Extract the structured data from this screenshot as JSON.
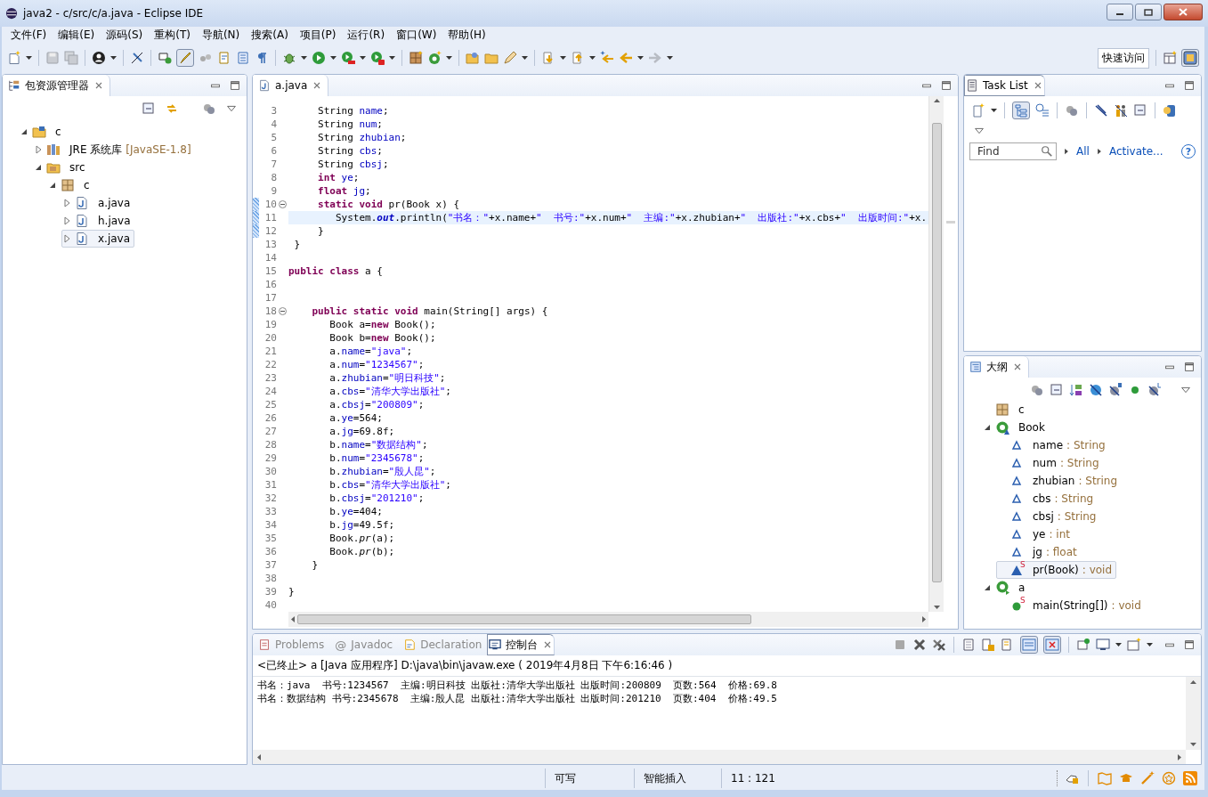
{
  "window": {
    "title": "java2 - c/src/c/a.java - Eclipse IDE"
  },
  "menu": [
    "文件(F)",
    "编辑(E)",
    "源码(S)",
    "重构(T)",
    "导航(N)",
    "搜索(A)",
    "项目(P)",
    "运行(R)",
    "窗口(W)",
    "帮助(H)"
  ],
  "toolbar": {
    "quick_access": "快速访问"
  },
  "package_explorer": {
    "title": "包资源管理器",
    "tree": [
      {
        "kind": "project",
        "label": "c",
        "expanded": true,
        "selected": false,
        "children": [
          {
            "kind": "library",
            "label": "JRE 系统库",
            "decoration": "[JavaSE-1.8]",
            "expanded": false,
            "selected": false
          },
          {
            "kind": "source-folder",
            "label": "src",
            "expanded": true,
            "selected": false,
            "children": [
              {
                "kind": "package",
                "label": "c",
                "expanded": true,
                "selected": false,
                "children": [
                  {
                    "kind": "java-file",
                    "label": "a.java",
                    "expanded": false,
                    "selected": false
                  },
                  {
                    "kind": "java-file",
                    "label": "h.java",
                    "expanded": false,
                    "selected": false
                  },
                  {
                    "kind": "java-file",
                    "label": "x.java",
                    "expanded": false,
                    "selected": true
                  }
                ]
              }
            ]
          }
        ]
      }
    ]
  },
  "editor": {
    "tabs": [
      {
        "label": "a.java",
        "selected": true
      }
    ],
    "lines": [
      {
        "number": "3",
        "current": false,
        "fold": false,
        "marked": false,
        "segments": [
          {
            "kind": "plain",
            "text": "     String "
          },
          {
            "kind": "field",
            "text": "name"
          },
          {
            "kind": "plain",
            "text": ";"
          }
        ]
      },
      {
        "number": "4",
        "current": false,
        "fold": false,
        "marked": false,
        "segments": [
          {
            "kind": "plain",
            "text": "     String "
          },
          {
            "kind": "field",
            "text": "num"
          },
          {
            "kind": "plain",
            "text": ";"
          }
        ]
      },
      {
        "number": "5",
        "current": false,
        "fold": false,
        "marked": false,
        "segments": [
          {
            "kind": "plain",
            "text": "     String "
          },
          {
            "kind": "field",
            "text": "zhubian"
          },
          {
            "kind": "plain",
            "text": ";"
          }
        ]
      },
      {
        "number": "6",
        "current": false,
        "fold": false,
        "marked": false,
        "segments": [
          {
            "kind": "plain",
            "text": "     String "
          },
          {
            "kind": "field",
            "text": "cbs"
          },
          {
            "kind": "plain",
            "text": ";"
          }
        ]
      },
      {
        "number": "7",
        "current": false,
        "fold": false,
        "marked": false,
        "segments": [
          {
            "kind": "plain",
            "text": "     String "
          },
          {
            "kind": "field",
            "text": "cbsj"
          },
          {
            "kind": "plain",
            "text": ";"
          }
        ]
      },
      {
        "number": "8",
        "current": false,
        "fold": false,
        "marked": false,
        "segments": [
          {
            "kind": "keyword",
            "text": "     int"
          },
          {
            "kind": "field",
            "text": " ye"
          },
          {
            "kind": "plain",
            "text": ";"
          }
        ]
      },
      {
        "number": "9",
        "current": false,
        "fold": false,
        "marked": false,
        "segments": [
          {
            "kind": "keyword",
            "text": "     float"
          },
          {
            "kind": "field",
            "text": " jg"
          },
          {
            "kind": "plain",
            "text": ";"
          }
        ]
      },
      {
        "number": "10",
        "current": false,
        "fold": true,
        "marked": true,
        "segments": [
          {
            "kind": "keyword",
            "text": "     static"
          },
          {
            "kind": "keyword",
            "text": " void"
          },
          {
            "kind": "plain",
            "text": " pr(Book x) {"
          }
        ]
      },
      {
        "number": "11",
        "current": true,
        "fold": false,
        "marked": true,
        "segments": [
          {
            "kind": "plain",
            "text": "        System."
          },
          {
            "kind": "static",
            "text": "out"
          },
          {
            "kind": "plain",
            "text": ".println("
          },
          {
            "kind": "string",
            "text": "\"书名：\""
          },
          {
            "kind": "plain",
            "text": "+x.name+"
          },
          {
            "kind": "string",
            "text": "\"  书号:\""
          },
          {
            "kind": "plain",
            "text": "+x.num+"
          },
          {
            "kind": "string",
            "text": "\"  主编:\""
          },
          {
            "kind": "plain",
            "text": "+x.zhubian+"
          },
          {
            "kind": "string",
            "text": "\"  出版社:\""
          },
          {
            "kind": "plain",
            "text": "+x.cbs+"
          },
          {
            "kind": "string",
            "text": "\"  出版时间:\""
          },
          {
            "kind": "plain",
            "text": "+x."
          }
        ]
      },
      {
        "number": "12",
        "current": false,
        "fold": false,
        "marked": true,
        "segments": [
          {
            "kind": "plain",
            "text": "     }"
          }
        ]
      },
      {
        "number": "13",
        "current": false,
        "fold": false,
        "marked": false,
        "segments": [
          {
            "kind": "plain",
            "text": " }"
          }
        ]
      },
      {
        "number": "14",
        "current": false,
        "fold": false,
        "marked": false
      },
      {
        "number": "15",
        "current": false,
        "fold": false,
        "marked": false,
        "segments": [
          {
            "kind": "keyword",
            "text": "public"
          },
          {
            "kind": "keyword",
            "text": " class"
          },
          {
            "kind": "plain",
            "text": " a {"
          }
        ]
      },
      {
        "number": "16",
        "current": false,
        "fold": false,
        "marked": false
      },
      {
        "number": "17",
        "current": false,
        "fold": false,
        "marked": false
      },
      {
        "number": "18",
        "current": false,
        "fold": true,
        "marked": false,
        "segments": [
          {
            "kind": "keyword",
            "text": "    public"
          },
          {
            "kind": "keyword",
            "text": " static"
          },
          {
            "kind": "keyword",
            "text": " void"
          },
          {
            "kind": "plain",
            "text": " main(String[] args) {"
          }
        ]
      },
      {
        "number": "19",
        "current": false,
        "fold": false,
        "marked": false,
        "segments": [
          {
            "kind": "plain",
            "text": "       Book a="
          },
          {
            "kind": "keyword",
            "text": "new"
          },
          {
            "kind": "plain",
            "text": " Book();"
          }
        ]
      },
      {
        "number": "20",
        "current": false,
        "fold": false,
        "marked": false,
        "segments": [
          {
            "kind": "plain",
            "text": "       Book b="
          },
          {
            "kind": "keyword",
            "text": "new"
          },
          {
            "kind": "plain",
            "text": " Book();"
          }
        ]
      },
      {
        "number": "21",
        "current": false,
        "fold": false,
        "marked": false,
        "segments": [
          {
            "kind": "plain",
            "text": "       a."
          },
          {
            "kind": "field",
            "text": "name"
          },
          {
            "kind": "plain",
            "text": "="
          },
          {
            "kind": "string",
            "text": "\"java\""
          },
          {
            "kind": "plain",
            "text": ";"
          }
        ]
      },
      {
        "number": "22",
        "current": false,
        "fold": false,
        "marked": false,
        "segments": [
          {
            "kind": "plain",
            "text": "       a."
          },
          {
            "kind": "field",
            "text": "num"
          },
          {
            "kind": "plain",
            "text": "="
          },
          {
            "kind": "string",
            "text": "\"1234567\""
          },
          {
            "kind": "plain",
            "text": ";"
          }
        ]
      },
      {
        "number": "23",
        "current": false,
        "fold": false,
        "marked": false,
        "segments": [
          {
            "kind": "plain",
            "text": "       a."
          },
          {
            "kind": "field",
            "text": "zhubian"
          },
          {
            "kind": "plain",
            "text": "="
          },
          {
            "kind": "string",
            "text": "\"明日科技\""
          },
          {
            "kind": "plain",
            "text": ";"
          }
        ]
      },
      {
        "number": "24",
        "current": false,
        "fold": false,
        "marked": false,
        "segments": [
          {
            "kind": "plain",
            "text": "       a."
          },
          {
            "kind": "field",
            "text": "cbs"
          },
          {
            "kind": "plain",
            "text": "="
          },
          {
            "kind": "string",
            "text": "\"清华大学出版社\""
          },
          {
            "kind": "plain",
            "text": ";"
          }
        ]
      },
      {
        "number": "25",
        "current": false,
        "fold": false,
        "marked": false,
        "segments": [
          {
            "kind": "plain",
            "text": "       a."
          },
          {
            "kind": "field",
            "text": "cbsj"
          },
          {
            "kind": "plain",
            "text": "="
          },
          {
            "kind": "string",
            "text": "\"200809\""
          },
          {
            "kind": "plain",
            "text": ";"
          }
        ]
      },
      {
        "number": "26",
        "current": false,
        "fold": false,
        "marked": false,
        "segments": [
          {
            "kind": "plain",
            "text": "       a."
          },
          {
            "kind": "field",
            "text": "ye"
          },
          {
            "kind": "plain",
            "text": "=564;"
          }
        ]
      },
      {
        "number": "27",
        "current": false,
        "fold": false,
        "marked": false,
        "segments": [
          {
            "kind": "plain",
            "text": "       a."
          },
          {
            "kind": "field",
            "text": "jg"
          },
          {
            "kind": "plain",
            "text": "=69.8f;"
          }
        ]
      },
      {
        "number": "28",
        "current": false,
        "fold": false,
        "marked": false,
        "segments": [
          {
            "kind": "plain",
            "text": "       b."
          },
          {
            "kind": "field",
            "text": "name"
          },
          {
            "kind": "plain",
            "text": "="
          },
          {
            "kind": "string",
            "text": "\"数据结构\""
          },
          {
            "kind": "plain",
            "text": ";"
          }
        ]
      },
      {
        "number": "29",
        "current": false,
        "fold": false,
        "marked": false,
        "segments": [
          {
            "kind": "plain",
            "text": "       b."
          },
          {
            "kind": "field",
            "text": "num"
          },
          {
            "kind": "plain",
            "text": "="
          },
          {
            "kind": "string",
            "text": "\"2345678\""
          },
          {
            "kind": "plain",
            "text": ";"
          }
        ]
      },
      {
        "number": "30",
        "current": false,
        "fold": false,
        "marked": false,
        "segments": [
          {
            "kind": "plain",
            "text": "       b."
          },
          {
            "kind": "field",
            "text": "zhubian"
          },
          {
            "kind": "plain",
            "text": "="
          },
          {
            "kind": "string",
            "text": "\"殷人昆\""
          },
          {
            "kind": "plain",
            "text": ";"
          }
        ]
      },
      {
        "number": "31",
        "current": false,
        "fold": false,
        "marked": false,
        "segments": [
          {
            "kind": "plain",
            "text": "       b."
          },
          {
            "kind": "field",
            "text": "cbs"
          },
          {
            "kind": "plain",
            "text": "="
          },
          {
            "kind": "string",
            "text": "\"清华大学出版社\""
          },
          {
            "kind": "plain",
            "text": ";"
          }
        ]
      },
      {
        "number": "32",
        "current": false,
        "fold": false,
        "marked": false,
        "segments": [
          {
            "kind": "plain",
            "text": "       b."
          },
          {
            "kind": "field",
            "text": "cbsj"
          },
          {
            "kind": "plain",
            "text": "="
          },
          {
            "kind": "string",
            "text": "\"201210\""
          },
          {
            "kind": "plain",
            "text": ";"
          }
        ]
      },
      {
        "number": "33",
        "current": false,
        "fold": false,
        "marked": false,
        "segments": [
          {
            "kind": "plain",
            "text": "       b."
          },
          {
            "kind": "field",
            "text": "ye"
          },
          {
            "kind": "plain",
            "text": "=404;"
          }
        ]
      },
      {
        "number": "34",
        "current": false,
        "fold": false,
        "marked": false,
        "segments": [
          {
            "kind": "plain",
            "text": "       b."
          },
          {
            "kind": "field",
            "text": "jg"
          },
          {
            "kind": "plain",
            "text": "=49.5f;"
          }
        ]
      },
      {
        "number": "35",
        "current": false,
        "fold": false,
        "marked": false,
        "segments": [
          {
            "kind": "plain",
            "text": "       Book."
          },
          {
            "kind": "static-call",
            "text": "pr"
          },
          {
            "kind": "plain",
            "text": "(a);"
          }
        ]
      },
      {
        "number": "36",
        "current": false,
        "fold": false,
        "marked": false,
        "segments": [
          {
            "kind": "plain",
            "text": "       Book."
          },
          {
            "kind": "static-call",
            "text": "pr"
          },
          {
            "kind": "plain",
            "text": "(b);"
          }
        ]
      },
      {
        "number": "37",
        "current": false,
        "fold": false,
        "marked": false,
        "segments": [
          {
            "kind": "plain",
            "text": "    }"
          }
        ]
      },
      {
        "number": "38",
        "current": false,
        "fold": false,
        "marked": false
      },
      {
        "number": "39",
        "current": false,
        "fold": false,
        "marked": false,
        "segments": [
          {
            "kind": "plain",
            "text": "}"
          }
        ]
      },
      {
        "number": "40",
        "current": false,
        "fold": false,
        "marked": false
      }
    ]
  },
  "task_list": {
    "title": "Task List",
    "find": {
      "placeholder": "Find"
    },
    "links": [
      "All",
      "Activate..."
    ],
    "help": "?"
  },
  "outline": {
    "title": "大纲",
    "tree": [
      {
        "kind": "package",
        "name": "c",
        "selected": false
      },
      {
        "kind": "class",
        "name": "Book",
        "expanded": true,
        "selected": false,
        "children": [
          {
            "kind": "field",
            "name": "name",
            "detail": ": String",
            "selected": false
          },
          {
            "kind": "field",
            "name": "num",
            "detail": ": String",
            "selected": false
          },
          {
            "kind": "field",
            "name": "zhubian",
            "detail": ": String",
            "selected": false
          },
          {
            "kind": "field",
            "name": "cbs",
            "detail": ": String",
            "selected": false
          },
          {
            "kind": "field",
            "name": "cbsj",
            "detail": ": String",
            "selected": false
          },
          {
            "kind": "field",
            "name": "ye",
            "detail": ": int",
            "selected": false
          },
          {
            "kind": "field",
            "name": "jg",
            "detail": ": float",
            "selected": false
          },
          {
            "kind": "static-method",
            "name": "pr(Book)",
            "modifier": "S",
            "detail": ": void",
            "selected": true
          }
        ]
      },
      {
        "kind": "main-class",
        "name": "a",
        "expanded": true,
        "selected": false,
        "children": [
          {
            "kind": "public-static-method",
            "name": "main(String[])",
            "modifier": "S",
            "detail": ": void",
            "selected": false
          }
        ]
      }
    ]
  },
  "console": {
    "tabs": [
      {
        "label": "Problems",
        "kind": "problems",
        "selected": false
      },
      {
        "label": "Javadoc",
        "kind": "javadoc",
        "glyph": "@",
        "selected": false
      },
      {
        "label": "Declaration",
        "kind": "declaration",
        "selected": false
      },
      {
        "label": "控制台",
        "kind": "console",
        "selected": true
      }
    ],
    "header": "<已终止> a [Java 应用程序] D:\\java\\bin\\javaw.exe ( 2019年4月8日 下午6:16:46 )",
    "output": [
      "书名：java  书号:1234567  主编:明日科技 出版社:清华大学出版社 出版时间:200809  页数:564  价格:69.8",
      "书名：数据结构 书号:2345678  主编:殷人昆 出版社:清华大学出版社 出版时间:201210  页数:404  价格:49.5"
    ]
  },
  "status_bar": {
    "fields": [
      "可写",
      "智能插入",
      "11 : 121"
    ]
  }
}
